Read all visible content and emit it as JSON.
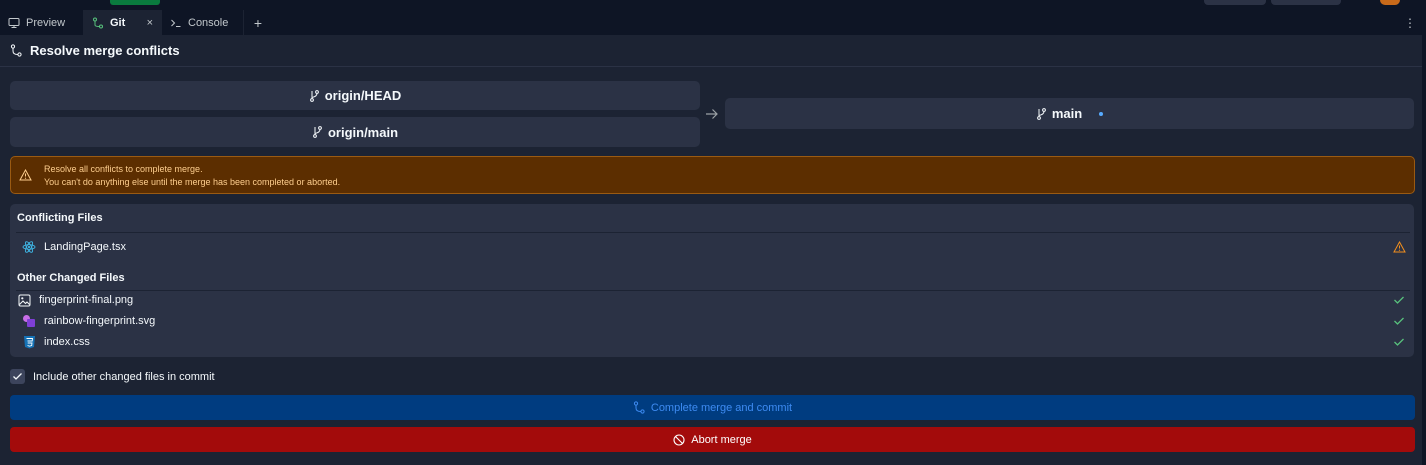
{
  "tabs": [
    {
      "label": "Preview",
      "icon": "monitor-icon"
    },
    {
      "label": "Git",
      "icon": "git-icon",
      "active": true,
      "close": "×"
    },
    {
      "label": "Console",
      "icon": "terminal-icon"
    }
  ],
  "tab_add": "+",
  "kebab": "⋮",
  "header": {
    "title": "Resolve merge conflicts",
    "icon": "merge-icon"
  },
  "branches": {
    "source1": "origin/HEAD",
    "source2": "origin/main",
    "target": "main"
  },
  "warning": {
    "line1": "Resolve all conflicts to complete merge.",
    "line2": "You can't do anything else until the merge has been completed or aborted."
  },
  "conflicting": {
    "title": "Conflicting Files",
    "files": [
      {
        "name": "LandingPage.tsx",
        "icon": "react-icon",
        "status": "warning"
      }
    ]
  },
  "other": {
    "title": "Other Changed Files",
    "files": [
      {
        "name": "fingerprint-final.png",
        "icon": "image-icon",
        "status": "ok"
      },
      {
        "name": "rainbow-fingerprint.svg",
        "icon": "svg-shapes-icon",
        "status": "ok"
      },
      {
        "name": "index.css",
        "icon": "css-icon",
        "status": "ok"
      }
    ]
  },
  "include": {
    "label": "Include other changed files in commit",
    "checked": true
  },
  "actions": {
    "complete": "Complete merge and commit",
    "abort": "Abort merge"
  },
  "colors": {
    "background": "#1c2333",
    "panel": "#2b3245",
    "warning_bg": "#5c2e00",
    "warning_text": "#ffcf8e",
    "primary_btn": "#003c80",
    "primary_text": "#3d8bf2",
    "danger_btn": "#a30b0b",
    "ok_check": "#58c27d",
    "warning_icon": "#f28f1d"
  }
}
